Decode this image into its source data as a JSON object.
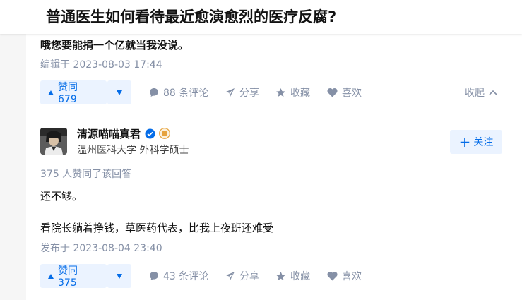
{
  "question": {
    "title": "普通医生如何看待最近愈演愈烈的医疗反腐?"
  },
  "answer1": {
    "last_line": "哦您要能捐一个亿就当我没说。",
    "edited": "编辑于 2023-08-03 17:44",
    "actions": {
      "upvote": "赞同 679",
      "comments": "88 条评论",
      "share": "分享",
      "favorite": "收藏",
      "like": "喜欢",
      "collapse": "收起"
    }
  },
  "answer2": {
    "author": {
      "name": "清源喵喵真君",
      "headline": "温州医科大学 外科学硕士",
      "verified_color": "#056de8",
      "badge_color": "#e6a23c"
    },
    "follow_label": "关注",
    "agree_count_text": "375 人赞同了该回答",
    "paragraphs": [
      "还不够。",
      "看院长躺着挣钱，草医药代表，比我上夜班还难受"
    ],
    "published": "发布于 2023-08-04 23:40",
    "actions": {
      "upvote": "赞同 375",
      "comments": "43 条评论",
      "share": "分享",
      "favorite": "收藏",
      "like": "喜欢"
    }
  },
  "colors": {
    "accent": "#056de8",
    "accent_bg": "#ebf3ff",
    "meta_gray": "#8590a6"
  }
}
